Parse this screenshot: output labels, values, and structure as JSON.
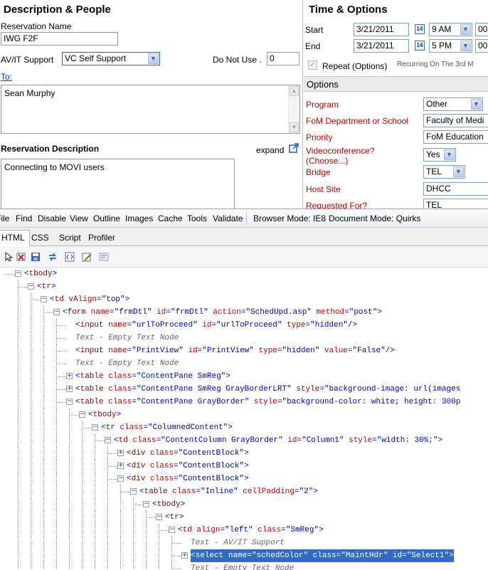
{
  "left_panel": {
    "title": "Description & People",
    "reservation_name_label": "Reservation Name",
    "reservation_name_value": "IWG F2F",
    "av_support_label": "AV/IT Support",
    "av_support_value": "VC Self Support",
    "do_not_use_label": "Do Not Use .",
    "do_not_use_value": "0",
    "to_link": "To:",
    "to_value": "Sean Murphy",
    "desc_label": "Reservation Description",
    "expand_link": "expand",
    "desc_value": "Connecting to MOVI users"
  },
  "right_panel": {
    "title": "Time & Options",
    "start_label": "Start",
    "start_date": "3/21/2011",
    "start_time": "9 AM",
    "start_min": "00",
    "end_label": "End",
    "end_date": "3/21/2011",
    "end_time": "5 PM",
    "end_min": "00",
    "cal_glyph": "14",
    "repeat_label": "Repeat (Options)",
    "recurring_text": "Recurring On The 3rd M",
    "options_header": "Options",
    "options": [
      {
        "label": "Program",
        "value": "Other",
        "type": "select"
      },
      {
        "label": "FoM Department or School",
        "value": "Faculty of Medi",
        "type": "text"
      },
      {
        "label": "Priority",
        "value": "FoM Education ",
        "type": "text"
      },
      {
        "label": "Videoconference?",
        "label2": "(Choose...)",
        "value": "Yes",
        "type": "select"
      },
      {
        "label": "Bridge",
        "value": "TEL",
        "type": "select"
      },
      {
        "label": "Host Site",
        "value": "DHCC",
        "type": "text"
      },
      {
        "label": "Requested For?",
        "value": "TEL",
        "type": "text"
      }
    ]
  },
  "devtools": {
    "menu": [
      "File",
      "Find",
      "Disable",
      "View",
      "Outline",
      "Images",
      "Cache",
      "Tools",
      "Validate"
    ],
    "browser_mode": "Browser Mode: IE8",
    "document_mode": "Document Mode: Quirks",
    "tabs": [
      "HTML",
      "CSS",
      "Script",
      "Profiler"
    ],
    "active_tab": "HTML",
    "tree": [
      {
        "depth": 1,
        "exp": "-",
        "parts": [
          [
            "pu",
            "<"
          ],
          [
            "tn",
            "tbody"
          ],
          [
            "pu",
            ">"
          ]
        ]
      },
      {
        "depth": 2,
        "exp": "-",
        "parts": [
          [
            "pu",
            "<"
          ],
          [
            "tn",
            "tr"
          ],
          [
            "pu",
            ">"
          ]
        ]
      },
      {
        "depth": 3,
        "exp": "-",
        "parts": [
          [
            "pu",
            "<"
          ],
          [
            "tn",
            "td"
          ],
          [
            "pu",
            " "
          ],
          [
            "an",
            "vAlign"
          ],
          [
            "pu",
            "=\""
          ],
          [
            "av",
            "top"
          ],
          [
            "pu",
            "\">"
          ]
        ]
      },
      {
        "depth": 4,
        "exp": "-",
        "parts": [
          [
            "pu",
            "<"
          ],
          [
            "tn",
            "form"
          ],
          [
            "pu",
            " "
          ],
          [
            "an",
            "name"
          ],
          [
            "pu",
            "=\""
          ],
          [
            "av",
            "frmDtl"
          ],
          [
            "pu",
            "\" "
          ],
          [
            "an",
            "id"
          ],
          [
            "pu",
            "=\""
          ],
          [
            "av",
            "frmDtl"
          ],
          [
            "pu",
            "\" "
          ],
          [
            "an",
            "action"
          ],
          [
            "pu",
            "=\""
          ],
          [
            "av",
            "SchedUpd.asp"
          ],
          [
            "pu",
            "\" "
          ],
          [
            "an",
            "method"
          ],
          [
            "pu",
            "=\""
          ],
          [
            "av",
            "post"
          ],
          [
            "pu",
            "\">"
          ]
        ]
      },
      {
        "depth": 5,
        "exp": "",
        "parts": [
          [
            "pu",
            "<"
          ],
          [
            "tn",
            "input"
          ],
          [
            "pu",
            " "
          ],
          [
            "an",
            "name"
          ],
          [
            "pu",
            "=\""
          ],
          [
            "av",
            "urlToProceed"
          ],
          [
            "pu",
            "\" "
          ],
          [
            "an",
            "id"
          ],
          [
            "pu",
            "=\""
          ],
          [
            "av",
            "urlToProceed"
          ],
          [
            "pu",
            "\" "
          ],
          [
            "an",
            "type"
          ],
          [
            "pu",
            "=\""
          ],
          [
            "av",
            "hidden"
          ],
          [
            "pu",
            "\"/>"
          ]
        ]
      },
      {
        "depth": 5,
        "exp": "",
        "parts": [
          [
            "tx",
            "Text - Empty Text Node"
          ]
        ]
      },
      {
        "depth": 5,
        "exp": "",
        "parts": [
          [
            "pu",
            "<"
          ],
          [
            "tn",
            "input"
          ],
          [
            "pu",
            " "
          ],
          [
            "an",
            "name"
          ],
          [
            "pu",
            "=\""
          ],
          [
            "av",
            "PrintView"
          ],
          [
            "pu",
            "\" "
          ],
          [
            "an",
            "id"
          ],
          [
            "pu",
            "=\""
          ],
          [
            "av",
            "PrintView"
          ],
          [
            "pu",
            "\" "
          ],
          [
            "an",
            "type"
          ],
          [
            "pu",
            "=\""
          ],
          [
            "av",
            "hidden"
          ],
          [
            "pu",
            "\" "
          ],
          [
            "an",
            "value"
          ],
          [
            "pu",
            "=\""
          ],
          [
            "av",
            "False"
          ],
          [
            "pu",
            "\"/>"
          ]
        ]
      },
      {
        "depth": 5,
        "exp": "",
        "parts": [
          [
            "tx",
            "Text - Empty Text Node"
          ]
        ]
      },
      {
        "depth": 5,
        "exp": "+",
        "parts": [
          [
            "pu",
            "<"
          ],
          [
            "tn",
            "table"
          ],
          [
            "pu",
            " "
          ],
          [
            "an",
            "class"
          ],
          [
            "pu",
            "=\""
          ],
          [
            "av",
            "ContentPane SmReg"
          ],
          [
            "pu",
            "\">"
          ]
        ]
      },
      {
        "depth": 5,
        "exp": "+",
        "parts": [
          [
            "pu",
            "<"
          ],
          [
            "tn",
            "table"
          ],
          [
            "pu",
            " "
          ],
          [
            "an",
            "class"
          ],
          [
            "pu",
            "=\""
          ],
          [
            "av",
            "ContentPane SmReg GrayBorderLRT"
          ],
          [
            "pu",
            "\" "
          ],
          [
            "an",
            "style"
          ],
          [
            "pu",
            "=\""
          ],
          [
            "av",
            "background-image: url(images"
          ]
        ]
      },
      {
        "depth": 5,
        "exp": "-",
        "parts": [
          [
            "pu",
            "<"
          ],
          [
            "tn",
            "table"
          ],
          [
            "pu",
            " "
          ],
          [
            "an",
            "class"
          ],
          [
            "pu",
            "=\""
          ],
          [
            "av",
            "ContentPane GrayBorder"
          ],
          [
            "pu",
            "\" "
          ],
          [
            "an",
            "style"
          ],
          [
            "pu",
            "=\""
          ],
          [
            "av",
            "background-color: white; height: 300p"
          ]
        ]
      },
      {
        "depth": 6,
        "exp": "-",
        "parts": [
          [
            "pu",
            "<"
          ],
          [
            "tn",
            "tbody"
          ],
          [
            "pu",
            ">"
          ]
        ]
      },
      {
        "depth": 7,
        "exp": "-",
        "parts": [
          [
            "pu",
            "<"
          ],
          [
            "tn",
            "tr"
          ],
          [
            "pu",
            " "
          ],
          [
            "an",
            "class"
          ],
          [
            "pu",
            "=\""
          ],
          [
            "av",
            "ColumnedContent"
          ],
          [
            "pu",
            "\">"
          ]
        ]
      },
      {
        "depth": 8,
        "exp": "-",
        "parts": [
          [
            "pu",
            "<"
          ],
          [
            "tn",
            "td"
          ],
          [
            "pu",
            " "
          ],
          [
            "an",
            "class"
          ],
          [
            "pu",
            "=\""
          ],
          [
            "av",
            "ContentColumn GrayBorder"
          ],
          [
            "pu",
            "\" "
          ],
          [
            "an",
            "id"
          ],
          [
            "pu",
            "=\""
          ],
          [
            "av",
            "Column1"
          ],
          [
            "pu",
            "\" "
          ],
          [
            "an",
            "style"
          ],
          [
            "pu",
            "=\""
          ],
          [
            "av",
            "width: 30%;"
          ],
          [
            "pu",
            "\">"
          ]
        ]
      },
      {
        "depth": 9,
        "exp": "+",
        "parts": [
          [
            "pu",
            "<"
          ],
          [
            "tn",
            "div"
          ],
          [
            "pu",
            " "
          ],
          [
            "an",
            "class"
          ],
          [
            "pu",
            "=\""
          ],
          [
            "av",
            "ContentBlock"
          ],
          [
            "pu",
            "\">"
          ]
        ]
      },
      {
        "depth": 9,
        "exp": "+",
        "parts": [
          [
            "pu",
            "<"
          ],
          [
            "tn",
            "div"
          ],
          [
            "pu",
            " "
          ],
          [
            "an",
            "class"
          ],
          [
            "pu",
            "=\""
          ],
          [
            "av",
            "ContentBlock"
          ],
          [
            "pu",
            "\">"
          ]
        ]
      },
      {
        "depth": 9,
        "exp": "-",
        "parts": [
          [
            "pu",
            "<"
          ],
          [
            "tn",
            "div"
          ],
          [
            "pu",
            " "
          ],
          [
            "an",
            "class"
          ],
          [
            "pu",
            "=\""
          ],
          [
            "av",
            "ContentBlock"
          ],
          [
            "pu",
            "\">"
          ]
        ]
      },
      {
        "depth": 10,
        "exp": "-",
        "parts": [
          [
            "pu",
            "<"
          ],
          [
            "tn",
            "table"
          ],
          [
            "pu",
            " "
          ],
          [
            "an",
            "class"
          ],
          [
            "pu",
            "=\""
          ],
          [
            "av",
            "Inline"
          ],
          [
            "pu",
            "\" "
          ],
          [
            "an",
            "cellPadding"
          ],
          [
            "pu",
            "=\""
          ],
          [
            "av",
            "2"
          ],
          [
            "pu",
            "\">"
          ]
        ]
      },
      {
        "depth": 11,
        "exp": "-",
        "parts": [
          [
            "pu",
            "<"
          ],
          [
            "tn",
            "tbody"
          ],
          [
            "pu",
            ">"
          ]
        ]
      },
      {
        "depth": 12,
        "exp": "-",
        "parts": [
          [
            "pu",
            "<"
          ],
          [
            "tn",
            "tr"
          ],
          [
            "pu",
            ">"
          ]
        ]
      },
      {
        "depth": 13,
        "exp": "-",
        "parts": [
          [
            "pu",
            "<"
          ],
          [
            "tn",
            "td"
          ],
          [
            "pu",
            " "
          ],
          [
            "an",
            "align"
          ],
          [
            "pu",
            "=\""
          ],
          [
            "av",
            "left"
          ],
          [
            "pu",
            "\" "
          ],
          [
            "an",
            "class"
          ],
          [
            "pu",
            "=\""
          ],
          [
            "av",
            "SmReg"
          ],
          [
            "pu",
            "\">"
          ]
        ]
      },
      {
        "depth": 14,
        "exp": "",
        "parts": [
          [
            "tx",
            "Text - AV/IT Support"
          ]
        ]
      },
      {
        "depth": 14,
        "exp": "+",
        "selected": true,
        "parts": [
          [
            "pu",
            "<"
          ],
          [
            "tn",
            "select"
          ],
          [
            "pu",
            " "
          ],
          [
            "an",
            "name"
          ],
          [
            "pu",
            "=\""
          ],
          [
            "av",
            "schedColor"
          ],
          [
            "pu",
            "\" "
          ],
          [
            "an",
            "class"
          ],
          [
            "pu",
            "=\""
          ],
          [
            "av",
            "MaintHdr"
          ],
          [
            "pu",
            "\" "
          ],
          [
            "an",
            "id"
          ],
          [
            "pu",
            "=\""
          ],
          [
            "av",
            "Select1"
          ],
          [
            "pu",
            "\">"
          ]
        ]
      },
      {
        "depth": 14,
        "exp": "",
        "parts": [
          [
            "tx",
            "Text - Empty Text Node"
          ]
        ]
      }
    ]
  }
}
